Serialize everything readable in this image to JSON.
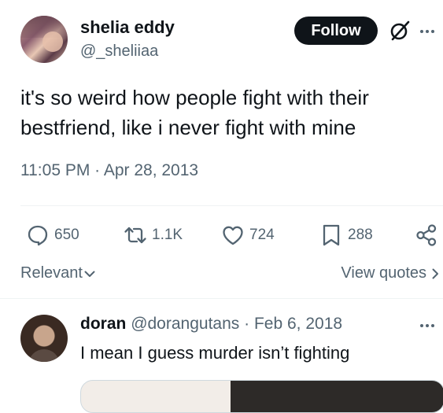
{
  "tweet": {
    "author": {
      "display_name": "shelia eddy",
      "handle": "@_sheliiaa"
    },
    "follow_label": "Follow",
    "text_line1": "it's so weird how people fight with their",
    "text_line2": "bestfriend, like i never fight with mine",
    "timestamp": "11:05 PM · Apr 28, 2013",
    "stats": {
      "replies": "650",
      "reposts": "1.1K",
      "likes": "724",
      "bookmarks": "288"
    }
  },
  "sort": {
    "label": "Relevant",
    "view_quotes": "View quotes"
  },
  "reply": {
    "display_name": "doran",
    "handle": "@dorangutans",
    "separator": "·",
    "date": "Feb 6, 2018",
    "text": "I mean I guess murder isn’t fighting"
  },
  "icons": [
    "grok-icon",
    "more-icon",
    "reply-icon",
    "repost-icon",
    "like-icon",
    "bookmark-icon",
    "share-icon",
    "chevron-down-icon",
    "chevron-right-icon"
  ],
  "colors": {
    "text": "#0f1419",
    "secondary": "#536471",
    "button": "#0f1419",
    "divider": "#eff3f4"
  }
}
